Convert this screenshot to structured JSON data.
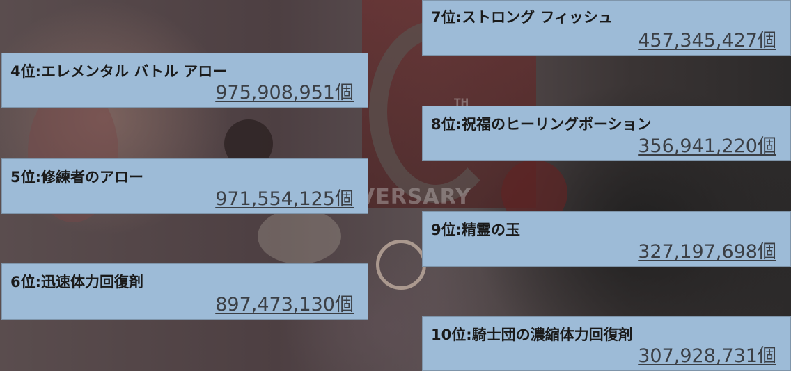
{
  "background": {
    "watermark_text": "VERSARY",
    "th_text": "TH"
  },
  "rankings": [
    {
      "rank_label": "4位:エレメンタル バトル アロー",
      "count": "975,908,951個"
    },
    {
      "rank_label": "5位:修練者のアロー",
      "count": "971,554,125個"
    },
    {
      "rank_label": "6位:迅速体力回復剤",
      "count": "897,473,130個"
    },
    {
      "rank_label": "7位:ストロング フィッシュ",
      "count": "457,345,427個"
    },
    {
      "rank_label": "8位:祝福のヒーリングポーション",
      "count": "356,941,220個"
    },
    {
      "rank_label": "9位:精霊の玉",
      "count": "327,197,698個"
    },
    {
      "rank_label": "10位:騎士団の濃縮体力回復剤",
      "count": "307,928,731個"
    }
  ],
  "colors": {
    "card_background": "#9dbbd7",
    "label_text": "#1a1a1a",
    "count_text": "#3b3f45"
  }
}
